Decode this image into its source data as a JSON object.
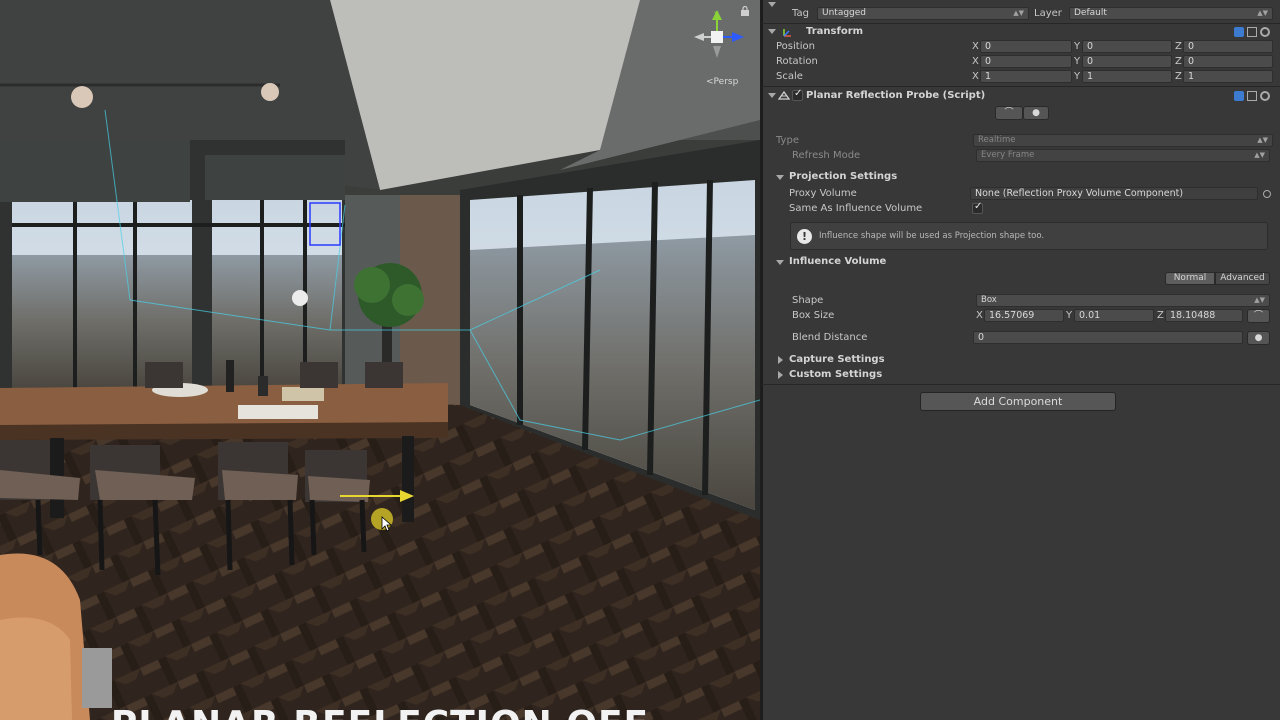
{
  "scene": {
    "view_mode": "Persp",
    "caption": "PLANAR REFLECTION OFF",
    "gizmo": {
      "y": "y",
      "x": "x",
      "z": "z"
    }
  },
  "inspector": {
    "tag_label": "Tag",
    "tag_value": "Untagged",
    "layer_label": "Layer",
    "layer_value": "Default",
    "transform": {
      "title": "Transform",
      "position_label": "Position",
      "rotation_label": "Rotation",
      "scale_label": "Scale",
      "position": {
        "x": "0",
        "y": "0",
        "z": "0"
      },
      "rotation": {
        "x": "0",
        "y": "0",
        "z": "0"
      },
      "scale": {
        "x": "1",
        "y": "1",
        "z": "1"
      }
    },
    "probe": {
      "title": "Planar Reflection Probe (Script)",
      "type_label": "Type",
      "type_value": "Realtime",
      "refresh_label": "Refresh Mode",
      "refresh_value": "Every Frame",
      "projection": {
        "title": "Projection Settings",
        "proxy_label": "Proxy Volume",
        "proxy_value": "None (Reflection Proxy Volume Component)",
        "same_label": "Same As Influence Volume",
        "same_checked": true,
        "info": "Influence shape will be used as Projection shape too."
      },
      "influence": {
        "title": "Influence Volume",
        "mode_normal": "Normal",
        "mode_advanced": "Advanced",
        "shape_label": "Shape",
        "shape_value": "Box",
        "box_label": "Box Size",
        "box": {
          "x": "16.57069",
          "y": "0.01",
          "z": "18.10488"
        },
        "blend_label": "Blend Distance",
        "blend_value": "0"
      },
      "capture_title": "Capture Settings",
      "custom_title": "Custom Settings"
    },
    "add_component": "Add Component"
  },
  "axis_labels": {
    "x": "X",
    "y": "Y",
    "z": "Z"
  },
  "colors": {
    "panel": "#383838",
    "field": "#4b4b4b",
    "accent_normal": "#5a5a5a"
  }
}
